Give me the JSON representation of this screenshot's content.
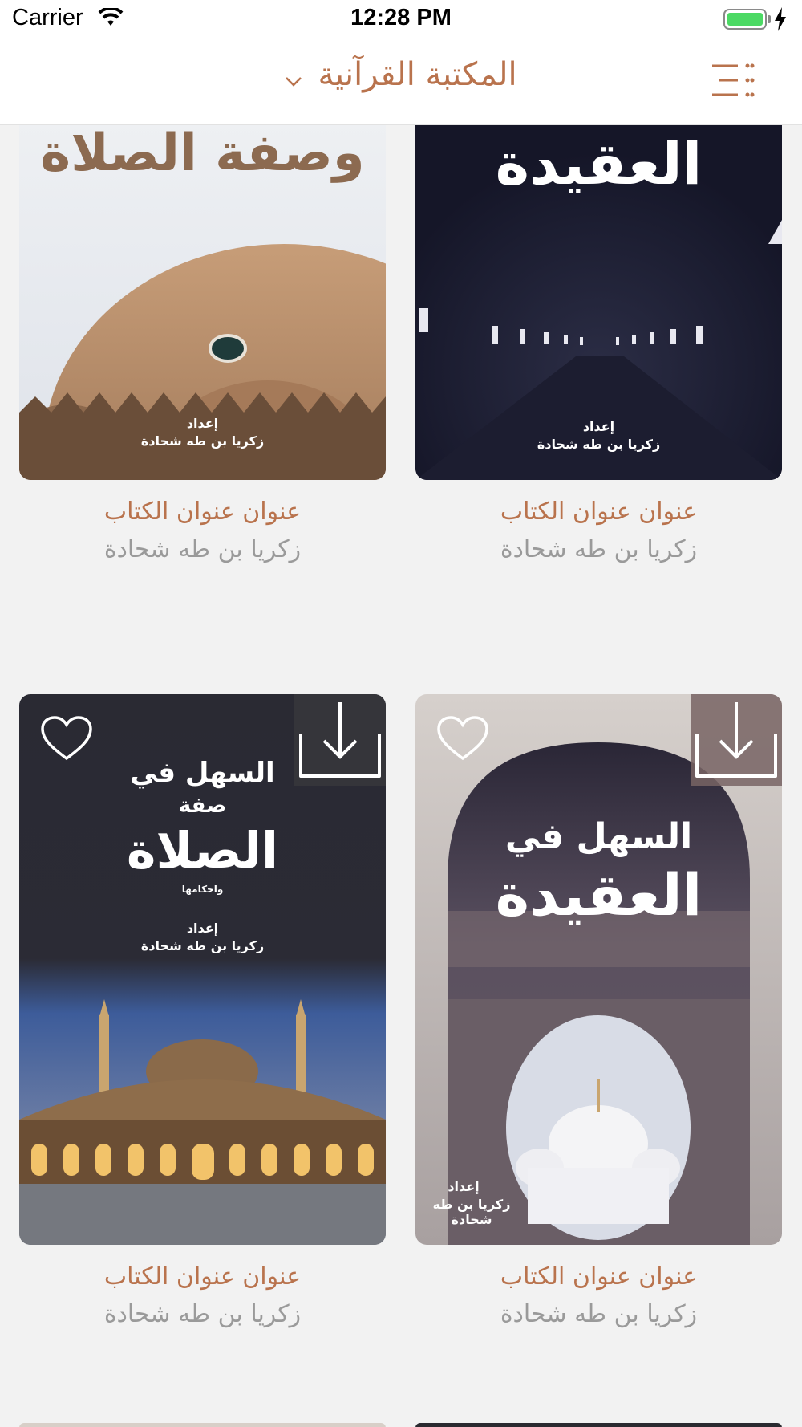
{
  "status_bar": {
    "carrier": "Carrier",
    "time": "12:28 PM",
    "battery_level": 1.0
  },
  "nav": {
    "title": "المكتبة القرآنية",
    "menu_icon": "menu-lines-icon",
    "dropdown_icon": "chevron-down-icon"
  },
  "colors": {
    "accent": "#b9734d",
    "secondary_text": "#9a9a9a",
    "background": "#f2f2f2",
    "battery": "#4cd964"
  },
  "books": [
    {
      "cover_title": "وصفة الصلاة",
      "cover_prepared_by": "إعداد",
      "cover_author": "زكريا بن طه شحادة",
      "title": "عنوان عنوان الكتاب",
      "author": "زكريا بن طه شحادة"
    },
    {
      "cover_title": "العقيدة",
      "cover_prepared_by": "إعداد",
      "cover_author": "زكريا بن طه شحادة",
      "title": "عنوان عنوان الكتاب",
      "author": "زكريا بن طه شحادة"
    },
    {
      "cover_title_line1": "السهل في",
      "cover_title_line2": "صفة",
      "cover_title_line3": "الصلاة",
      "cover_title_line4": "واحكامها",
      "cover_prepared_by": "إعداد",
      "cover_author": "زكريا بن طه شحادة",
      "title": "عنوان عنوان الكتاب",
      "author": "زكريا بن طه شحادة",
      "icons": [
        "heart-icon",
        "download-icon"
      ]
    },
    {
      "cover_title_line1": "السهل في",
      "cover_title_line2": "العقيدة",
      "cover_prepared_by": "إعداد",
      "cover_author": "زكريا بن طه شحادة",
      "title": "عنوان عنوان الكتاب",
      "author": "زكريا بن طه شحادة",
      "icons": [
        "heart-icon",
        "download-icon"
      ]
    }
  ]
}
